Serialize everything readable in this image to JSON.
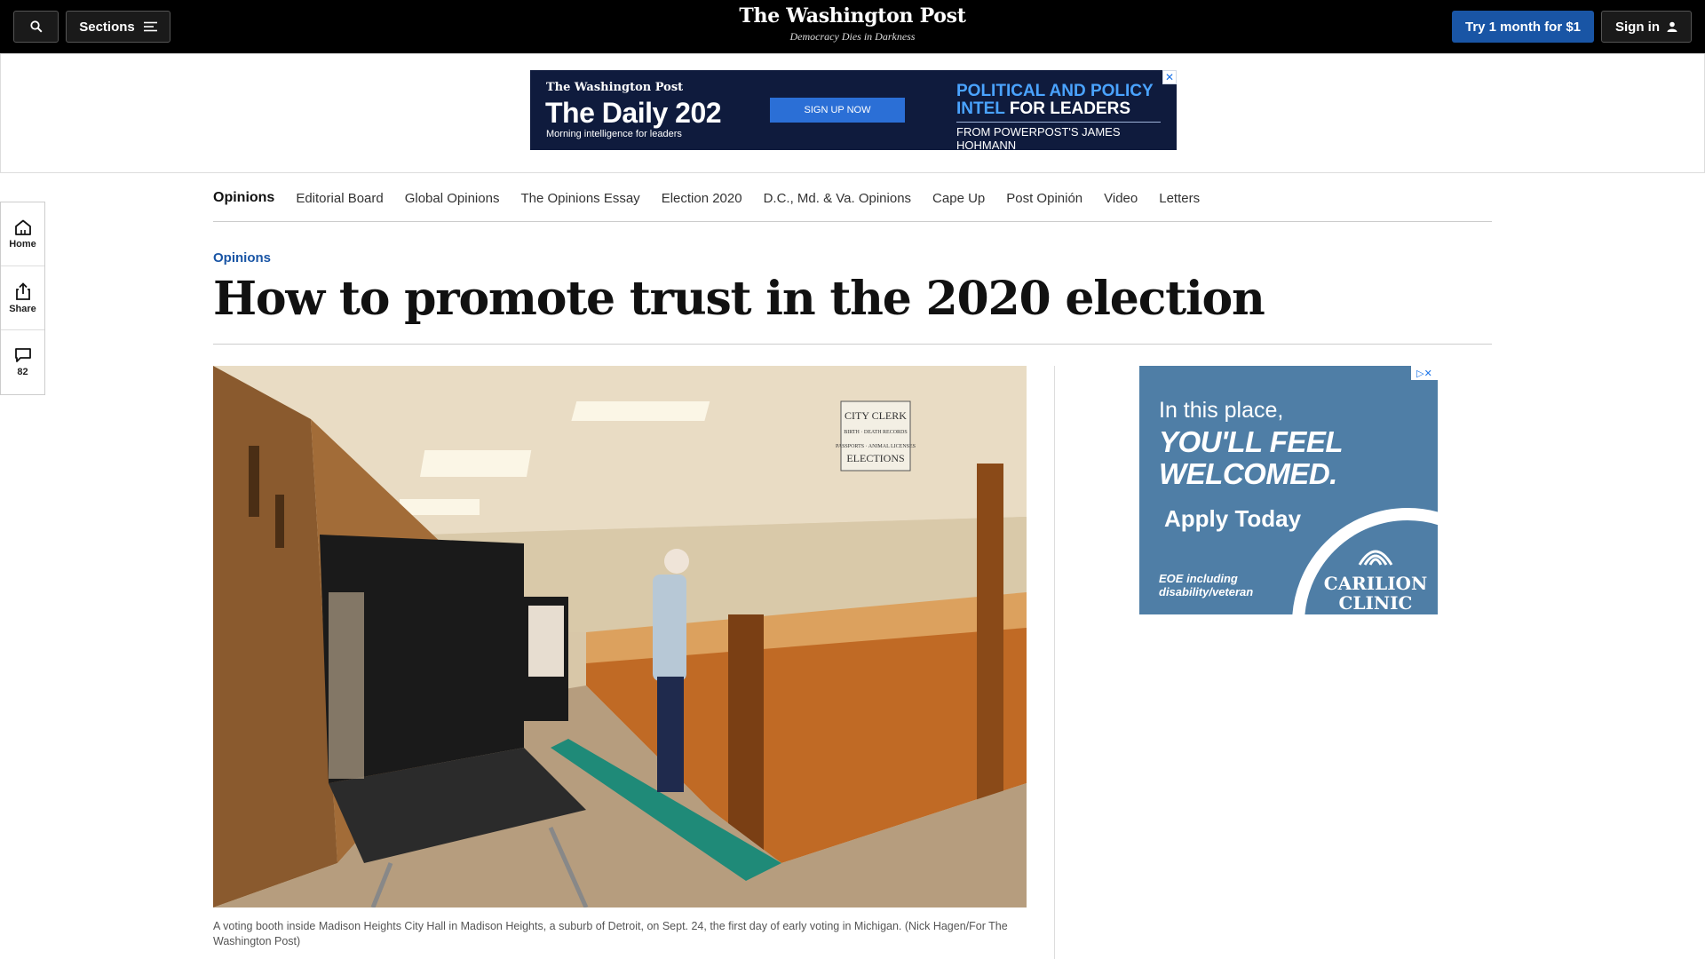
{
  "header": {
    "sections_label": "Sections",
    "logo": "The Washington Post",
    "tagline": "Democracy Dies in Darkness",
    "try_label": "Try 1 month for $1",
    "signin_label": "Sign in"
  },
  "top_ad": {
    "brand": "The Washington Post",
    "title": "The Daily 202",
    "subtitle": "Morning intelligence for leaders",
    "cta": "SIGN UP NOW",
    "headline_blue": "POLITICAL AND POLICY INTEL",
    "headline_white": "FOR LEADERS",
    "byline": "FROM POWERPOST'S JAMES HOHMANN",
    "close": "✕"
  },
  "section_nav": {
    "items": [
      "Opinions",
      "Editorial Board",
      "Global Opinions",
      "The Opinions Essay",
      "Election 2020",
      "D.C., Md. & Va. Opinions",
      "Cape Up",
      "Post Opinión",
      "Video",
      "Letters"
    ]
  },
  "rail": {
    "home": "Home",
    "share": "Share",
    "comments": "82"
  },
  "article": {
    "kicker": "Opinions",
    "headline": "How to promote trust in the 2020 election",
    "caption": "A voting booth inside Madison Heights City Hall in Madison Heights, a suburb of Detroit, on Sept. 24, the first day of early voting in Michigan. (Nick Hagen/For The Washington Post)",
    "photo_sign": [
      "CITY CLERK",
      "BIRTH · DEATH RECORDS",
      "PASSPORTS · ANIMAL LICENSES",
      "ELECTIONS"
    ]
  },
  "side_ad": {
    "line1": "In this place,",
    "line2a": "YOU'LL FEEL",
    "line2b": "WELCOMED.",
    "line3": "Apply Today",
    "line4a": "EOE including",
    "line4b": "disability/veteran",
    "brand_a": "CARILION",
    "brand_b": "CLINIC",
    "adchoice": "▷✕"
  },
  "colors": {
    "accent": "#1955a5",
    "topbar": "#000000",
    "ad_navy": "#0f1b3d",
    "side_ad_blue": "#4f7ea6"
  }
}
